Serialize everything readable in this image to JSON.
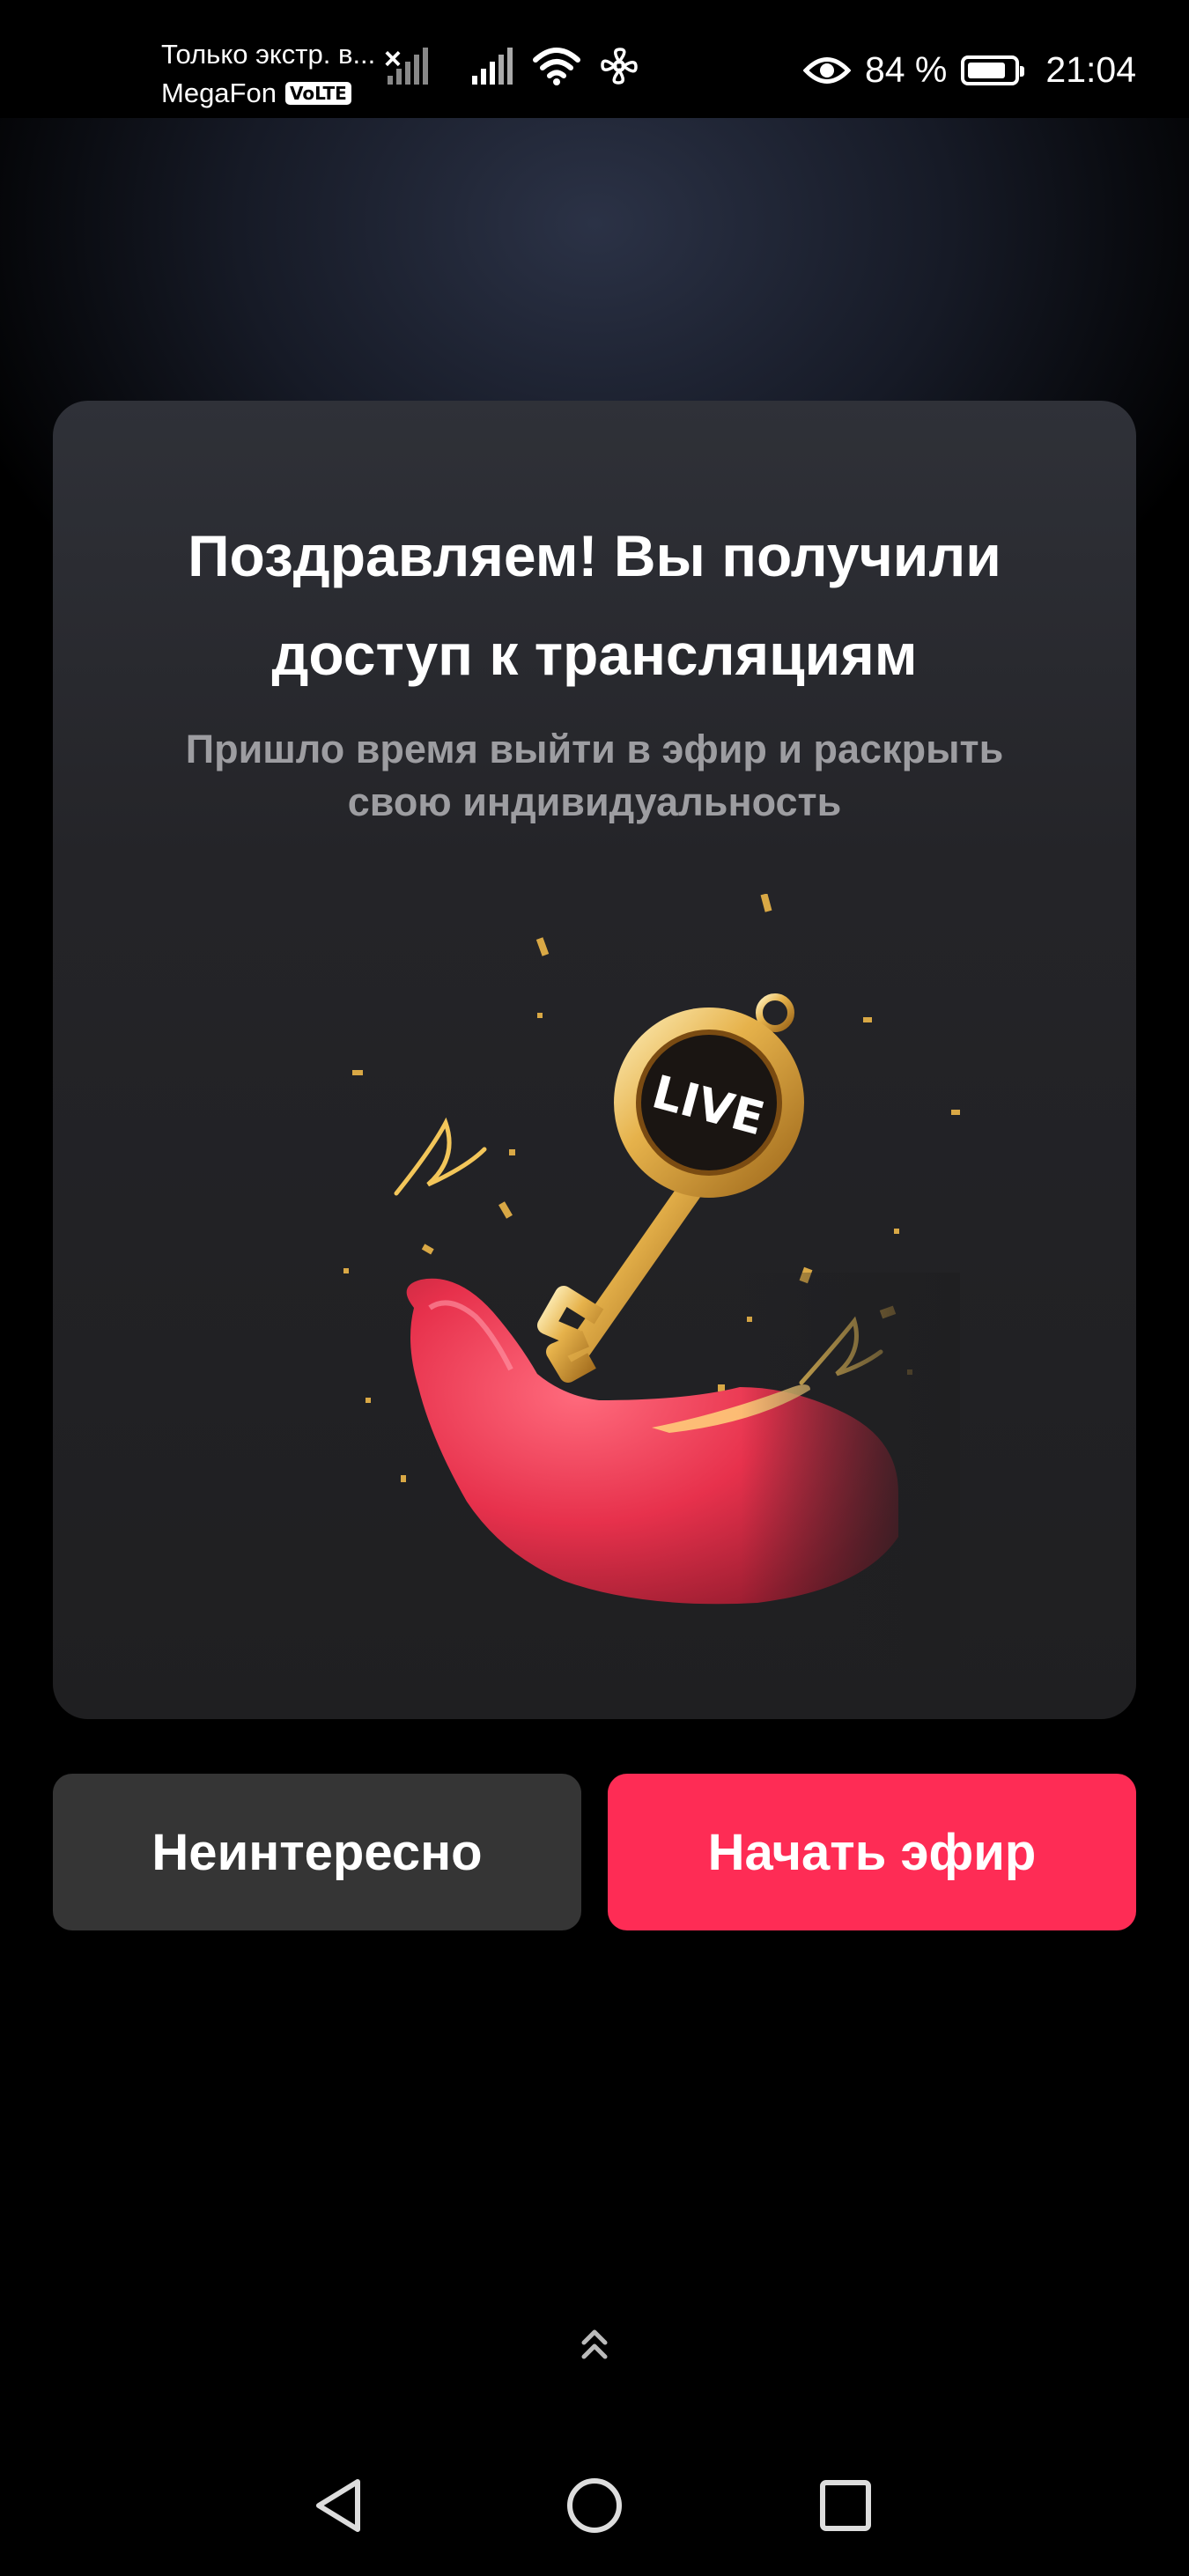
{
  "status_bar": {
    "carrier_line1": "Только экстр. в...",
    "carrier_line2": "MegaFon",
    "volte": "VoLTE",
    "battery_text": "84 %",
    "battery_level": 0.84,
    "time": "21:04"
  },
  "card": {
    "title": "Поздравляем! Вы получили доступ к трансляциям",
    "subtitle": "Пришло время выйти в эфир и раскрыть свою индивидуальность",
    "illustration_label": "LIVE"
  },
  "buttons": {
    "secondary_label": "Неинтересно",
    "primary_label": "Начать эфир"
  },
  "colors": {
    "primary": "#fe2c55",
    "secondary": "#353535",
    "card": "#242428"
  },
  "icons": [
    "close-icon",
    "signal-icon",
    "wifi-icon",
    "fan-icon",
    "eye-icon",
    "battery-icon",
    "swipe-up-icon",
    "back-icon",
    "home-icon",
    "recents-icon"
  ]
}
